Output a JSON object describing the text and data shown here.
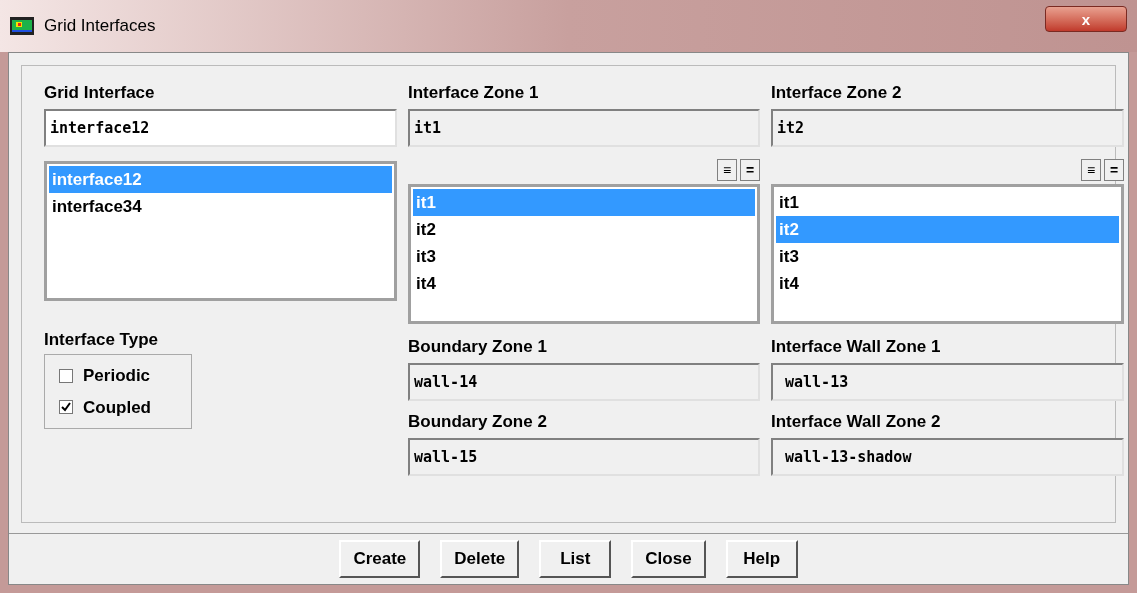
{
  "window": {
    "title": "Grid Interfaces",
    "close": "x"
  },
  "grid_interface": {
    "label": "Grid Interface",
    "value": "interface12",
    "items": [
      {
        "label": "interface12",
        "selected": true
      },
      {
        "label": "interface34",
        "selected": false
      }
    ]
  },
  "zone1": {
    "label": "Interface Zone 1",
    "value": "it1",
    "buttons": [
      "≡",
      "="
    ],
    "items": [
      {
        "label": "it1",
        "selected": true
      },
      {
        "label": "it2",
        "selected": false
      },
      {
        "label": "it3",
        "selected": false
      },
      {
        "label": "it4",
        "selected": false
      }
    ]
  },
  "zone2": {
    "label": "Interface Zone 2",
    "value": "it2",
    "buttons": [
      "≡",
      "="
    ],
    "items": [
      {
        "label": "it1",
        "selected": false
      },
      {
        "label": "it2",
        "selected": true
      },
      {
        "label": "it3",
        "selected": false
      },
      {
        "label": "it4",
        "selected": false
      }
    ]
  },
  "interface_type": {
    "label": "Interface Type",
    "options": [
      {
        "label": "Periodic",
        "checked": false
      },
      {
        "label": "Coupled",
        "checked": true
      }
    ]
  },
  "boundary_zone_1": {
    "label": "Boundary Zone 1",
    "value": "wall-14"
  },
  "interface_wall_zone_1": {
    "label": "Interface Wall Zone 1",
    "value": "wall-13"
  },
  "boundary_zone_2": {
    "label": "Boundary Zone 2",
    "value": "wall-15"
  },
  "interface_wall_zone_2": {
    "label": "Interface Wall Zone 2",
    "value": "wall-13-shadow"
  },
  "buttons": [
    "Create",
    "Delete",
    "List",
    "Close",
    "Help"
  ]
}
